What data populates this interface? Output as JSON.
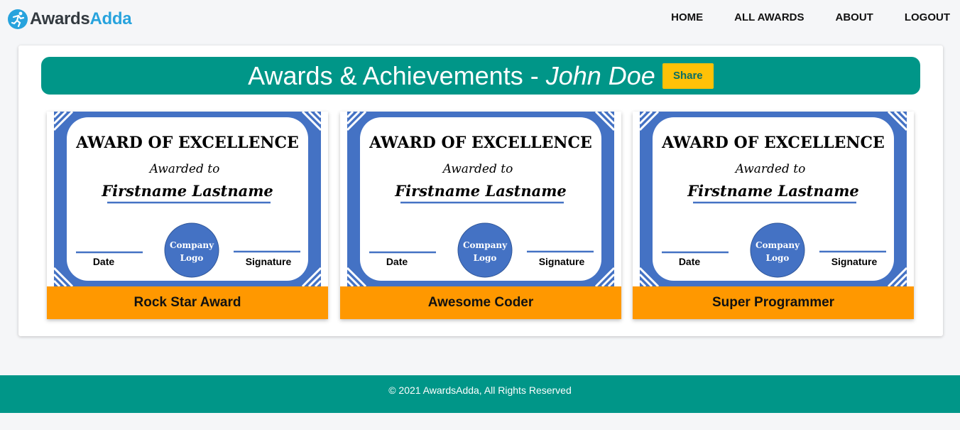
{
  "brand": {
    "part1": "Awards",
    "part2": "Adda",
    "icon": "award-runner-icon"
  },
  "nav": [
    {
      "label": "HOME"
    },
    {
      "label": "ALL AWARDS"
    },
    {
      "label": "ABOUT"
    },
    {
      "label": "LOGOUT"
    }
  ],
  "banner": {
    "title": "Awards & Achievements - ",
    "name": "John Doe",
    "share_label": "Share"
  },
  "certificate": {
    "heading": "AWARD OF EXCELLENCE",
    "awarded": "Awarded to",
    "recipient": "Firstname Lastname",
    "date": "Date",
    "signature": "Signature",
    "logo_line1": "Company",
    "logo_line2": "Logo"
  },
  "awards": [
    {
      "title": "Rock Star Award"
    },
    {
      "title": "Awesome Coder"
    },
    {
      "title": "Super Programmer"
    }
  ],
  "footer": {
    "text": "© 2021 AwardsAdda, All Rights Reserved"
  },
  "colors": {
    "teal": "#009688",
    "amber": "#ffc107",
    "orange": "#ff9800",
    "cert_blue": "#4472c4",
    "brand_blue": "#27a3dd"
  }
}
